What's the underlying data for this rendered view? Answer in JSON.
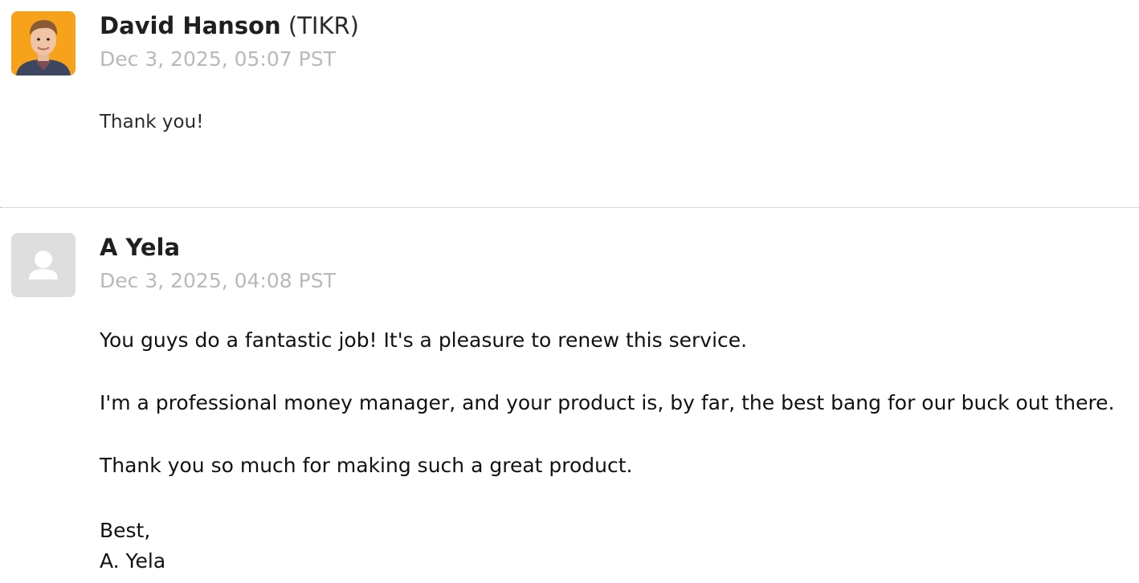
{
  "messages": [
    {
      "author": "David Hanson",
      "organization": "(TIKR)",
      "timestamp": "Dec 3, 2025, 05:07 PST",
      "avatar": "photo-avatar",
      "avatar_bg": "#f7a21b",
      "body": [
        "Thank you!"
      ]
    },
    {
      "author": "A Yela",
      "organization": "",
      "timestamp": "Dec 3, 2025, 04:08 PST",
      "avatar": "default-user-icon",
      "avatar_bg": "#dedede",
      "body": [
        "You guys do a fantastic job! It's a pleasure to renew this service.",
        "I'm a professional money manager, and your product is, by far, the best bang for our buck out there.",
        "Thank you so much for making such a great product."
      ],
      "signoff": "Best,",
      "signature": "A. Yela"
    }
  ]
}
